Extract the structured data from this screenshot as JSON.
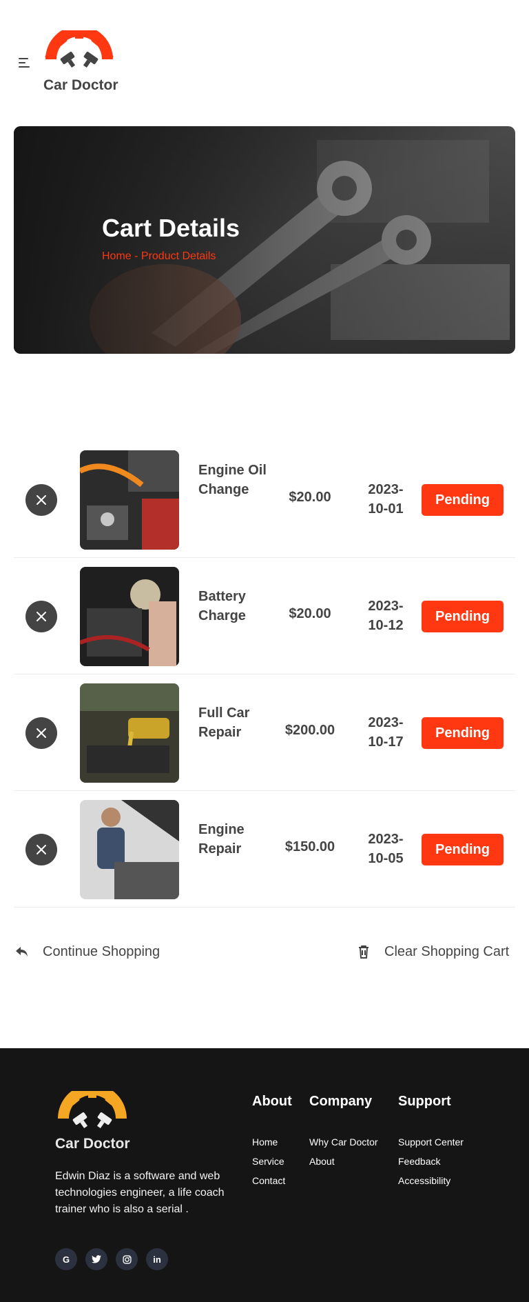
{
  "header": {
    "logo_text": "Car Doctor",
    "menu_icon": "hamburger-menu-icon"
  },
  "banner": {
    "title": "Cart Details",
    "breadcrumb": "Home - Product Details"
  },
  "cart": {
    "items": [
      {
        "name": "Engine Oil Change",
        "price": "$20.00",
        "date_year": "2023-",
        "date_rest": "10-01",
        "status": "Pending"
      },
      {
        "name": "Battery Charge",
        "price": "$20.00",
        "date_year": "2023-",
        "date_rest": "10-12",
        "status": "Pending"
      },
      {
        "name": "Full Car Repair",
        "price": "$200.00",
        "date_year": "2023-",
        "date_rest": "10-17",
        "status": "Pending"
      },
      {
        "name": "Engine Repair",
        "price": "$150.00",
        "date_year": "2023-",
        "date_rest": "10-05",
        "status": "Pending"
      }
    ]
  },
  "actions": {
    "continue": "Continue Shopping",
    "clear": "Clear Shopping Cart"
  },
  "footer": {
    "logo_text": "Car Doctor",
    "description": "Edwin Diaz is a software and web technologies engineer, a life coach trainer who is also a serial .",
    "socials": [
      "G",
      "twitter-icon",
      "instagram-icon",
      "in"
    ],
    "columns": [
      {
        "title": "About",
        "links": [
          "Home",
          "Service",
          "Contact"
        ]
      },
      {
        "title": "Company",
        "links": [
          "Why Car Doctor",
          "About"
        ]
      },
      {
        "title": "Support",
        "links": [
          "Support Center",
          "Feedback",
          "Accessibility"
        ]
      }
    ]
  },
  "colors": {
    "accent": "#ff3811",
    "text": "#444444",
    "footer_bg": "#151515",
    "footer_logo_accent": "#f5a623"
  }
}
